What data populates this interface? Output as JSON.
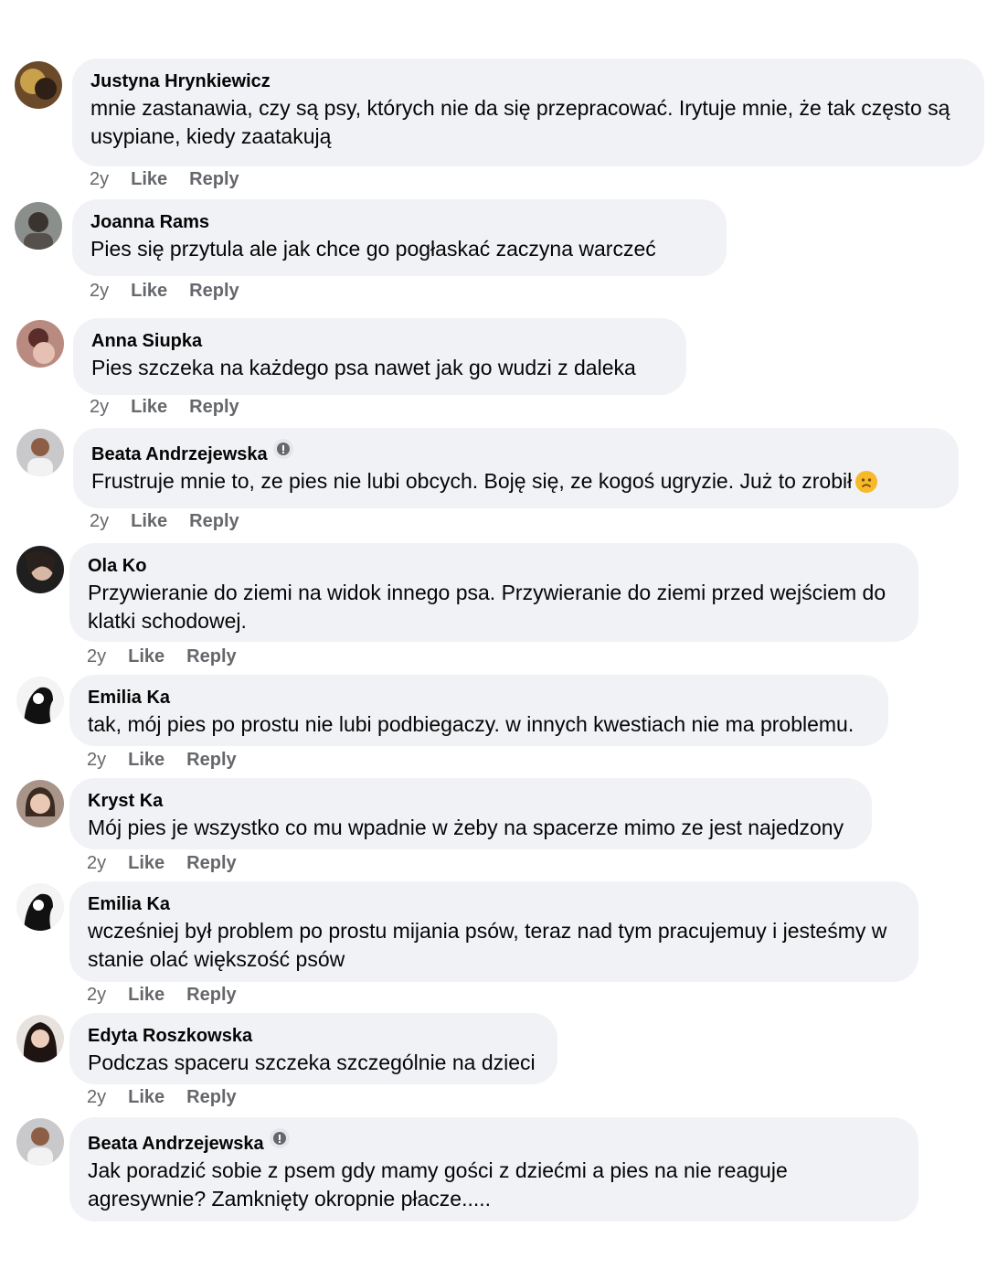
{
  "comments": [
    {
      "author": "Justyna Hrynkiewicz",
      "text": "mnie zastanawia, czy są psy, których nie da się przepracować. Irytuje mnie, że tak często są usypiane, kiedy zaatakują",
      "time": "2y",
      "like": "Like",
      "reply": "Reply"
    },
    {
      "author": "Joanna Rams",
      "text": "Pies się przytula ale jak chce go pogłaskać zaczyna warczeć",
      "time": "2y",
      "like": "Like",
      "reply": "Reply"
    },
    {
      "author": "Anna Siupka",
      "text": "Pies szczeka na każdego psa nawet jak go wudzi z daleka",
      "time": "2y",
      "like": "Like",
      "reply": "Reply"
    },
    {
      "author": "Beata Andrzejewska",
      "text": "Frustruje mnie to, ze pies nie lubi obcych. Boję się, ze kogoś ugryzie. Już to zrobił",
      "time": "2y",
      "like": "Like",
      "reply": "Reply",
      "badge_icon": "author-badge-icon",
      "emoji": "frowning-face-emoji"
    },
    {
      "author": "Ola Ko",
      "text": "Przywieranie do ziemi na widok innego psa. Przywieranie do ziemi przed wejściem do klatki schodowej.",
      "time": "2y",
      "like": "Like",
      "reply": "Reply"
    },
    {
      "author": "Emilia Ka",
      "text": "tak, mój pies po prostu nie lubi podbiegaczy. w innych kwestiach nie ma problemu.",
      "time": "2y",
      "like": "Like",
      "reply": "Reply"
    },
    {
      "author": "Kryst Ka",
      "text": "Mój pies je wszystko co mu wpadnie w żeby na spacerze mimo ze jest najedzony",
      "time": "2y",
      "like": "Like",
      "reply": "Reply"
    },
    {
      "author": "Emilia Ka",
      "text": "wcześniej był problem po prostu mijania psów, teraz nad tym pracujemuy i jesteśmy w stanie olać większość psów",
      "time": "2y",
      "like": "Like",
      "reply": "Reply"
    },
    {
      "author": "Edyta Roszkowska",
      "text": "Podczas spaceru szczeka szczególnie na dzieci",
      "time": "2y",
      "like": "Like",
      "reply": "Reply"
    },
    {
      "author": "Beata Andrzejewska",
      "text": "Jak poradzić sobie z psem gdy mamy gości z dziećmi a pies na nie reaguje agresywnie? Zamknięty okropnie płacze.....",
      "badge_icon": "author-badge-icon"
    }
  ],
  "colors": {
    "bubble": "#f0f2f5",
    "meta": "#65676b",
    "text": "#050505",
    "emoji": "#f7b928"
  }
}
